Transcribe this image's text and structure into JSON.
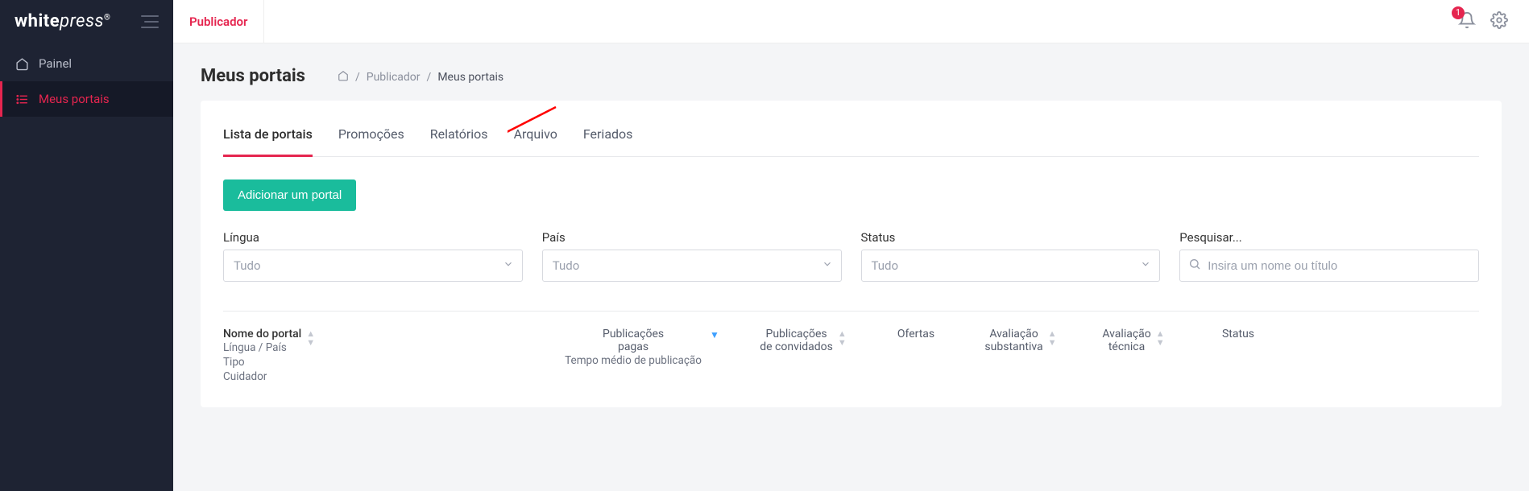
{
  "brand": {
    "bold": "white",
    "rest": "press",
    "reg": "®"
  },
  "sidebar": {
    "items": [
      {
        "label": "Painel",
        "icon": "home-icon"
      },
      {
        "label": "Meus portais",
        "icon": "list-icon"
      }
    ]
  },
  "topbar": {
    "publisher_tab": "Publicador",
    "notification_count": "1"
  },
  "page": {
    "title": "Meus portais",
    "breadcrumb": {
      "publisher": "Publicador",
      "current": "Meus portais"
    }
  },
  "tabs": [
    {
      "label": "Lista de portais"
    },
    {
      "label": "Promoções"
    },
    {
      "label": "Relatórios"
    },
    {
      "label": "Arquivo"
    },
    {
      "label": "Feriados"
    }
  ],
  "buttons": {
    "add_portal": "Adicionar um portal"
  },
  "filters": {
    "language": {
      "label": "Língua",
      "value": "Tudo"
    },
    "country": {
      "label": "País",
      "value": "Tudo"
    },
    "status": {
      "label": "Status",
      "value": "Tudo"
    },
    "search": {
      "label": "Pesquisar...",
      "placeholder": "Insira um nome ou título"
    }
  },
  "table": {
    "headers": {
      "portal_name": "Nome do portal",
      "portal_sub1": "Língua / País",
      "portal_sub2": "Tipo",
      "portal_sub3": "Cuidador",
      "paid_pub": "Publicações",
      "paid_pub2": "pagas",
      "paid_sub": "Tempo médio de publicação",
      "guest_pub": "Publicações",
      "guest_pub2": "de convidados",
      "offers": "Ofertas",
      "eval_sub": "Avaliação",
      "eval_sub2": "substantiva",
      "eval_tech": "Avaliação",
      "eval_tech2": "técnica",
      "status": "Status"
    }
  }
}
